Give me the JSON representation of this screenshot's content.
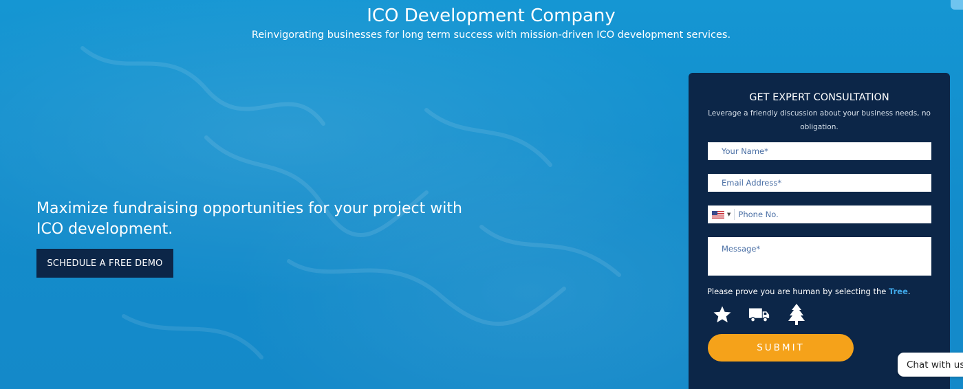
{
  "header": {
    "title": "ICO Development Company",
    "subtitle": "Reinvigorating businesses for long term success with mission-driven ICO development services."
  },
  "hero": {
    "headline": "Maximize fundraising opportunities for your project with ICO development.",
    "cta_label": "SCHEDULE A FREE DEMO"
  },
  "form": {
    "title": "GET EXPERT CONSULTATION",
    "subtitle": "Leverage a friendly discussion about your business needs, no obligation.",
    "name_placeholder": "Your Name*",
    "email_placeholder": "Email Address*",
    "phone_placeholder": "Phone No.",
    "message_placeholder": "Message*",
    "country_flag": "us-flag-icon",
    "captcha_prompt": "Please prove you are human by selecting the ",
    "captcha_target": "Tree",
    "captcha_period": ".",
    "captcha_options": [
      "star-icon",
      "truck-icon",
      "tree-icon"
    ],
    "submit_label": "SUBMIT"
  },
  "chat": {
    "label": "Chat with us"
  },
  "colors": {
    "background": "#1592cf",
    "panel": "#0c2648",
    "accent": "#f5a21a",
    "link": "#3fa6e6"
  }
}
